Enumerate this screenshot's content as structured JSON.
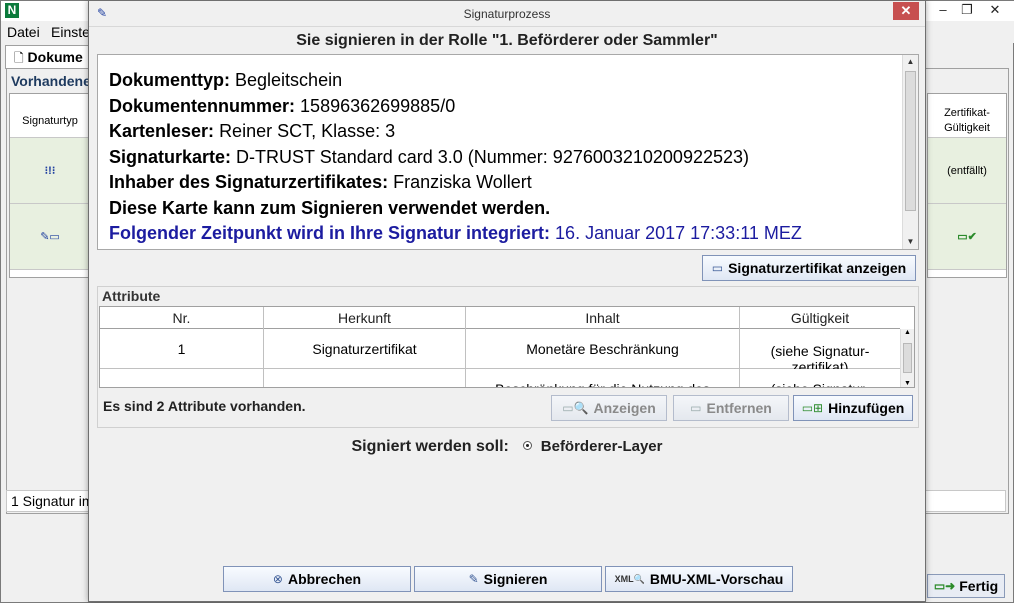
{
  "background_app": {
    "logo": "N",
    "menu": [
      "Datei",
      "Einste"
    ],
    "tab_label": "Dokume",
    "section_label": "Vorhandene",
    "left_column_header": "Signaturtyp",
    "right_column_header": "Zertifikat-Gültigkeit",
    "right_cell_text": "(entfällt)",
    "status_text": "1 Signatur im",
    "fertig_label": "Fertig",
    "window_controls": [
      "–",
      "❐",
      "✕"
    ]
  },
  "dialog": {
    "title": "Signaturprozess",
    "role_heading": "Sie signieren in der Rolle \"1. Beförderer oder Sammler\"",
    "info": {
      "doc_type_label": "Dokumenttyp:",
      "doc_type_value": "Begleitschein",
      "doc_number_label": "Dokumentennummer:",
      "doc_number_value": "15896362699885/0",
      "reader_label": "Kartenleser:",
      "reader_value": "Reiner SCT, Klasse: 3",
      "card_label": "Signaturkarte:",
      "card_value": "D-TRUST Standard card 3.0 (Nummer: 9276003210200922523)",
      "holder_label": "Inhaber des Signaturzertifikates:",
      "holder_value": "Franziska Wollert",
      "card_ok_text": "Diese Karte kann zum Signieren verwendet werden.",
      "timestamp_label": "Folgender Zeitpunkt wird in Ihre Signatur integriert:",
      "timestamp_value": "16. Januar 2017 17:33:11 MEZ"
    },
    "show_cert_button": "Signaturzertifikat anzeigen",
    "attributes": {
      "legend": "Attribute",
      "columns": [
        "Nr.",
        "Herkunft",
        "Inhalt",
        "Gültigkeit"
      ],
      "rows": [
        {
          "nr": "1",
          "herkunft": "Signaturzertifikat",
          "inhalt": "Monetäre Beschränkung",
          "gueltigkeit": "(siehe Signatur-zertifikat)"
        },
        {
          "nr": "",
          "herkunft": "",
          "inhalt": "Beschränkung für die Nutzung des",
          "gueltigkeit": "(siehe Signatur-"
        }
      ],
      "count_text": "Es sind 2 Attribute vorhanden.",
      "buttons": {
        "show": "Anzeigen",
        "remove": "Entfernen",
        "add": "Hinzufügen"
      }
    },
    "layer": {
      "label": "Signiert werden soll:",
      "option": "Beförderer-Layer"
    },
    "footer_buttons": {
      "cancel": "Abbrechen",
      "sign": "Signieren",
      "preview": "BMU-XML-Vorschau"
    },
    "colors": {
      "timestamp_blue": "#1c1ca0",
      "close_red": "#c75050",
      "logo_green": "#0b7a3b"
    }
  }
}
